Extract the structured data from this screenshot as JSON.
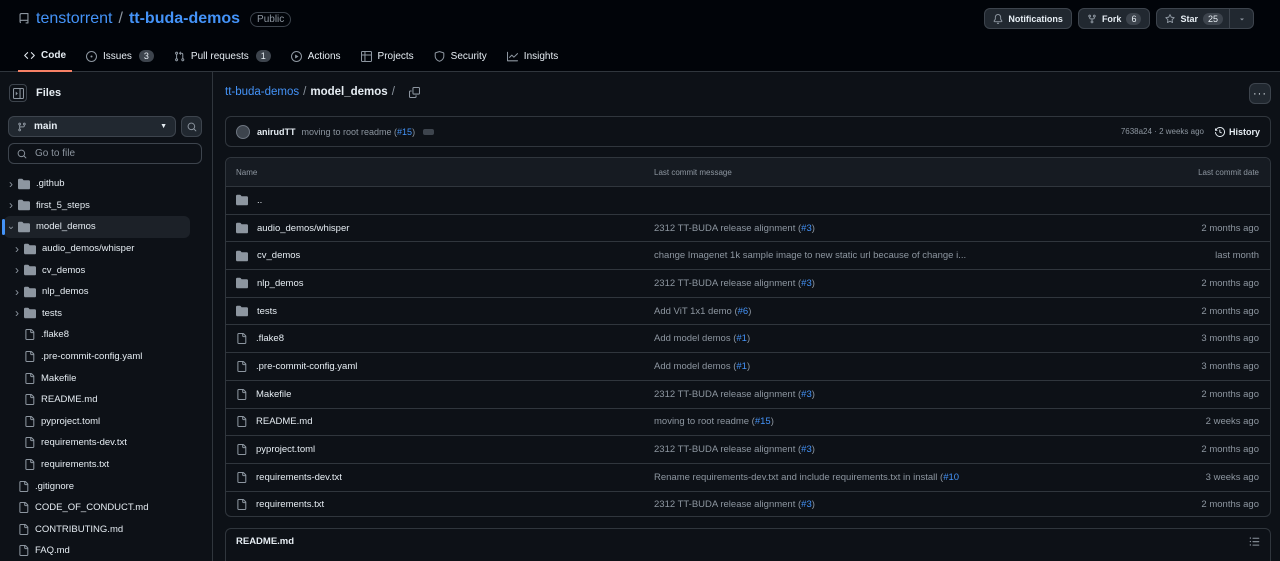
{
  "repo": {
    "owner": "tenstorrent",
    "separator": "/",
    "name": "tt-buda-demos",
    "visibility": "Public"
  },
  "header_actions": {
    "notifications": "Notifications",
    "fork": "Fork",
    "fork_count": "6",
    "star": "Star",
    "star_count": "25"
  },
  "tabs": [
    {
      "label": "Code",
      "icon": "code-icon"
    },
    {
      "label": "Issues",
      "count": "3",
      "icon": "issue-icon"
    },
    {
      "label": "Pull requests",
      "count": "1",
      "icon": "pull-request-icon"
    },
    {
      "label": "Actions",
      "icon": "play-icon"
    },
    {
      "label": "Projects",
      "icon": "table-icon"
    },
    {
      "label": "Security",
      "icon": "shield-icon"
    },
    {
      "label": "Insights",
      "icon": "graph-icon"
    }
  ],
  "sidebar": {
    "title": "Files",
    "branch": "main",
    "goto_placeholder": "Go to file",
    "tree": [
      {
        "label": ".github",
        "type": "folder",
        "depth": 0,
        "expandable": true
      },
      {
        "label": "first_5_steps",
        "type": "folder",
        "depth": 0,
        "expandable": true
      },
      {
        "label": "model_demos",
        "type": "folder",
        "depth": 0,
        "expandable": true,
        "expanded": true,
        "selected": true
      },
      {
        "label": "audio_demos/whisper",
        "type": "folder",
        "depth": 1,
        "expandable": true
      },
      {
        "label": "cv_demos",
        "type": "folder",
        "depth": 1,
        "expandable": true
      },
      {
        "label": "nlp_demos",
        "type": "folder",
        "depth": 1,
        "expandable": true
      },
      {
        "label": "tests",
        "type": "folder",
        "depth": 1,
        "expandable": true
      },
      {
        "label": ".flake8",
        "type": "file",
        "depth": 1
      },
      {
        "label": ".pre-commit-config.yaml",
        "type": "file",
        "depth": 1
      },
      {
        "label": "Makefile",
        "type": "file",
        "depth": 1
      },
      {
        "label": "README.md",
        "type": "file",
        "depth": 1
      },
      {
        "label": "pyproject.toml",
        "type": "file",
        "depth": 1
      },
      {
        "label": "requirements-dev.txt",
        "type": "file",
        "depth": 1
      },
      {
        "label": "requirements.txt",
        "type": "file",
        "depth": 1
      },
      {
        "label": ".gitignore",
        "type": "file",
        "depth": 0
      },
      {
        "label": "CODE_OF_CONDUCT.md",
        "type": "file",
        "depth": 0
      },
      {
        "label": "CONTRIBUTING.md",
        "type": "file",
        "depth": 0
      },
      {
        "label": "FAQ.md",
        "type": "file",
        "depth": 0
      }
    ]
  },
  "breadcrumb": {
    "root": "tt-buda-demos",
    "sep": "/",
    "current": "model_demos",
    "trailing": "/"
  },
  "latest_commit": {
    "author": "anirudTT",
    "message": "moving to root readme (",
    "pr": "#15",
    "message_end": ")",
    "sha_time": "7638a24 · 2 weeks ago",
    "history": "History"
  },
  "table": {
    "headers": {
      "name": "Name",
      "message": "Last commit message",
      "date": "Last commit date"
    },
    "parent": "..",
    "rows": [
      {
        "name": "audio_demos/whisper",
        "type": "folder",
        "msg": "2312 TT-BUDA release alignment (",
        "pr": "#3",
        "msg_end": ")",
        "date": "2 months ago"
      },
      {
        "name": "cv_demos",
        "type": "folder",
        "msg": "change Imagenet 1k sample image to new static url because of change i...",
        "pr": "",
        "msg_end": "",
        "date": "last month"
      },
      {
        "name": "nlp_demos",
        "type": "folder",
        "msg": "2312 TT-BUDA release alignment (",
        "pr": "#3",
        "msg_end": ")",
        "date": "2 months ago"
      },
      {
        "name": "tests",
        "type": "folder",
        "msg": "Add ViT 1x1 demo (",
        "pr": "#6",
        "msg_end": ")",
        "date": "2 months ago"
      },
      {
        "name": ".flake8",
        "type": "file",
        "msg": "Add model demos (",
        "pr": "#1",
        "msg_end": ")",
        "date": "3 months ago"
      },
      {
        "name": ".pre-commit-config.yaml",
        "type": "file",
        "msg": "Add model demos (",
        "pr": "#1",
        "msg_end": ")",
        "date": "3 months ago"
      },
      {
        "name": "Makefile",
        "type": "file",
        "msg": "2312 TT-BUDA release alignment (",
        "pr": "#3",
        "msg_end": ")",
        "date": "2 months ago"
      },
      {
        "name": "README.md",
        "type": "file",
        "msg": "moving to root readme (",
        "pr": "#15",
        "msg_end": ")",
        "date": "2 weeks ago"
      },
      {
        "name": "pyproject.toml",
        "type": "file",
        "msg": "2312 TT-BUDA release alignment (",
        "pr": "#3",
        "msg_end": ")",
        "date": "2 months ago"
      },
      {
        "name": "requirements-dev.txt",
        "type": "file",
        "msg": "Rename requirements-dev.txt and include requirements.txt in install (",
        "pr": "#10",
        "msg_end": "",
        "date": "3 weeks ago"
      },
      {
        "name": "requirements.txt",
        "type": "file",
        "msg": "2312 TT-BUDA release alignment (",
        "pr": "#3",
        "msg_end": ")",
        "date": "2 months ago"
      }
    ]
  },
  "readme": {
    "title": "README.md"
  },
  "colors": {
    "accent": "#4493f8",
    "tab_underline": "#f78166",
    "background": "#0d1117"
  }
}
